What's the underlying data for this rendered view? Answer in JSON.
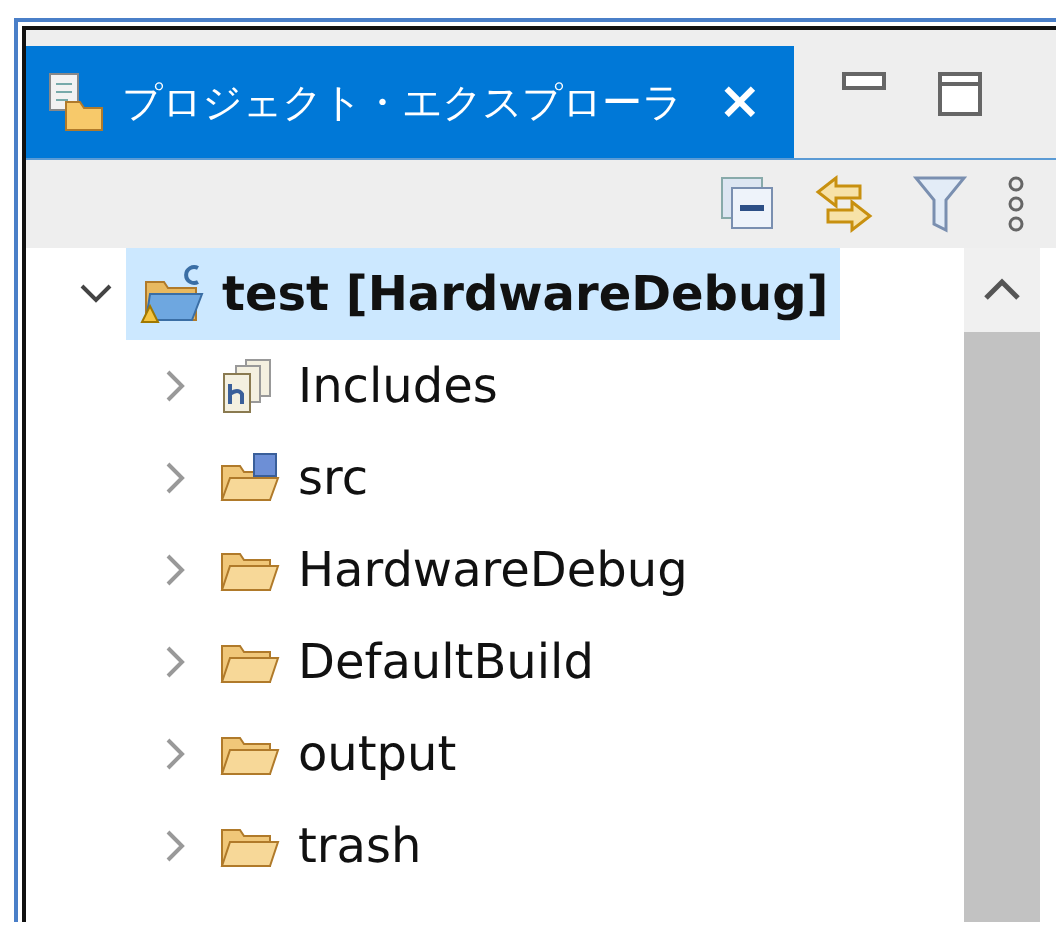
{
  "tab": {
    "title": "プロジェクト・エクスプローラ",
    "selected": true,
    "close": "×"
  },
  "tree": {
    "label": "test [HardwareDebug]",
    "kind": "project",
    "expanded": true,
    "selected": true,
    "children": [
      {
        "label": "Includes",
        "kind": "includes",
        "expanded": false,
        "selected": false
      },
      {
        "label": "src",
        "kind": "source-folder",
        "expanded": false,
        "selected": false
      },
      {
        "label": "HardwareDebug",
        "kind": "folder",
        "expanded": false,
        "selected": false
      },
      {
        "label": "DefaultBuild",
        "kind": "folder",
        "expanded": false,
        "selected": false
      },
      {
        "label": "output",
        "kind": "folder",
        "expanded": false,
        "selected": false
      },
      {
        "label": "trash",
        "kind": "folder",
        "expanded": false,
        "selected": false
      }
    ]
  }
}
